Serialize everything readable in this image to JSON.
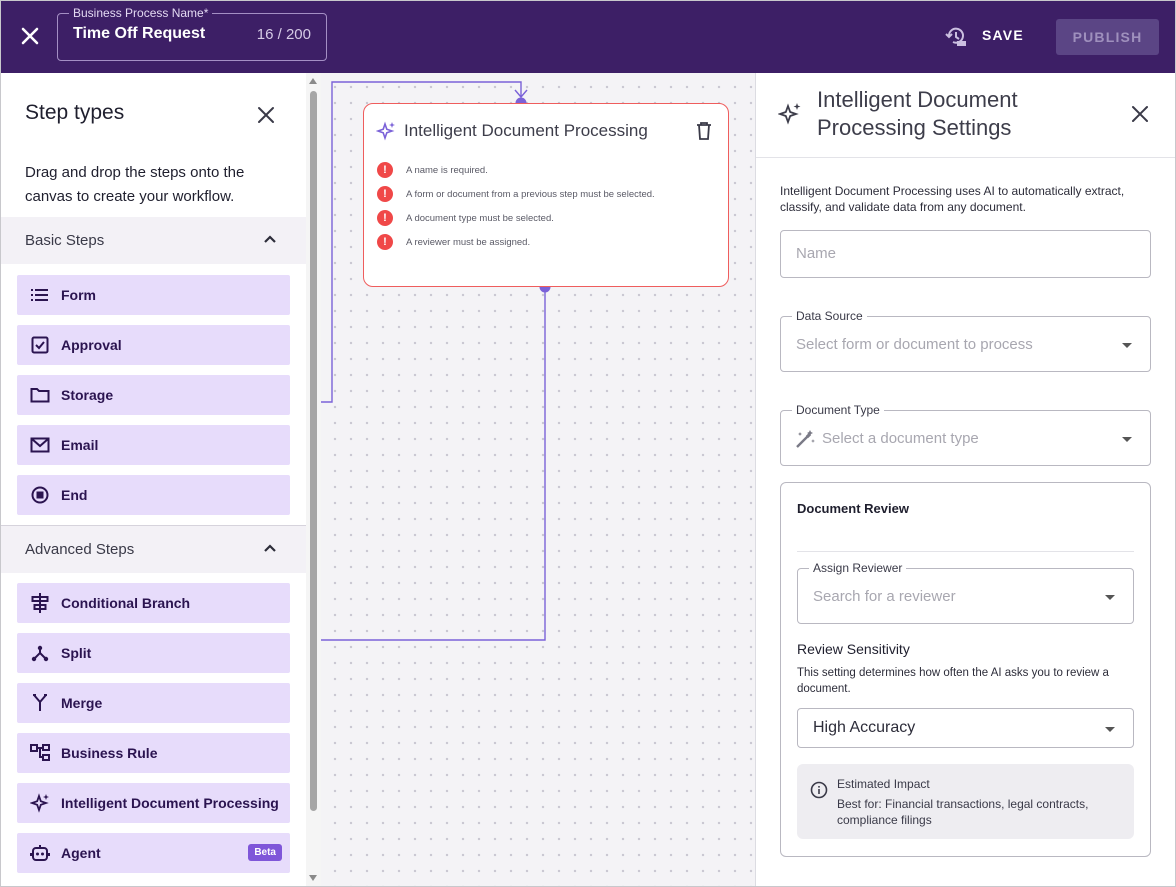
{
  "header": {
    "name_legend": "Business Process Name*",
    "name_value": "Time Off Request",
    "char_count": "16 / 200",
    "save_label": "SAVE",
    "publish_label": "PUBLISH"
  },
  "left_panel": {
    "title": "Step types",
    "description": "Drag and drop the steps onto the canvas to create your workflow.",
    "basic_section": {
      "label": "Basic Steps",
      "items": [
        {
          "label": "Form",
          "icon": "list-icon"
        },
        {
          "label": "Approval",
          "icon": "checkbox-icon"
        },
        {
          "label": "Storage",
          "icon": "folder-icon"
        },
        {
          "label": "Email",
          "icon": "mail-icon"
        },
        {
          "label": "End",
          "icon": "stop-circle-icon"
        }
      ]
    },
    "advanced_section": {
      "label": "Advanced Steps",
      "items": [
        {
          "label": "Conditional Branch",
          "icon": "branch-icon"
        },
        {
          "label": "Split",
          "icon": "split-icon"
        },
        {
          "label": "Merge",
          "icon": "merge-icon"
        },
        {
          "label": "Business Rule",
          "icon": "rule-icon"
        },
        {
          "label": "Intelligent Document Processing",
          "icon": "sparkle-icon"
        },
        {
          "label": "Agent",
          "icon": "robot-icon",
          "badge": "Beta"
        }
      ]
    }
  },
  "canvas": {
    "node": {
      "title": "Intelligent Document Processing",
      "errors": [
        "A name is required.",
        "A form or document from a previous step must be selected.",
        "A document type must be selected.",
        "A reviewer must be assigned."
      ]
    }
  },
  "right_panel": {
    "title": "Intelligent Document Processing Settings",
    "description": "Intelligent Document Processing uses AI to automatically extract, classify, and validate data from any document.",
    "name_placeholder": "Name",
    "data_source": {
      "label": "Data Source",
      "placeholder": "Select form or document to process"
    },
    "document_type": {
      "label": "Document Type",
      "placeholder": "Select a document type"
    },
    "review": {
      "title": "Document Review",
      "assign_label": "Assign Reviewer",
      "assign_placeholder": "Search for a reviewer",
      "sensitivity_title": "Review Sensitivity",
      "sensitivity_desc": "This setting determines how often the AI asks you to review a document.",
      "sensitivity_value": "High Accuracy",
      "impact_title": "Estimated Impact",
      "impact_desc": "Best for: Financial transactions, legal contracts, compliance filings"
    }
  },
  "colors": {
    "header_bg": "#3d1f66",
    "step_bg": "#e7dcfb",
    "accent": "#7f56d9",
    "error": "#f04848"
  }
}
